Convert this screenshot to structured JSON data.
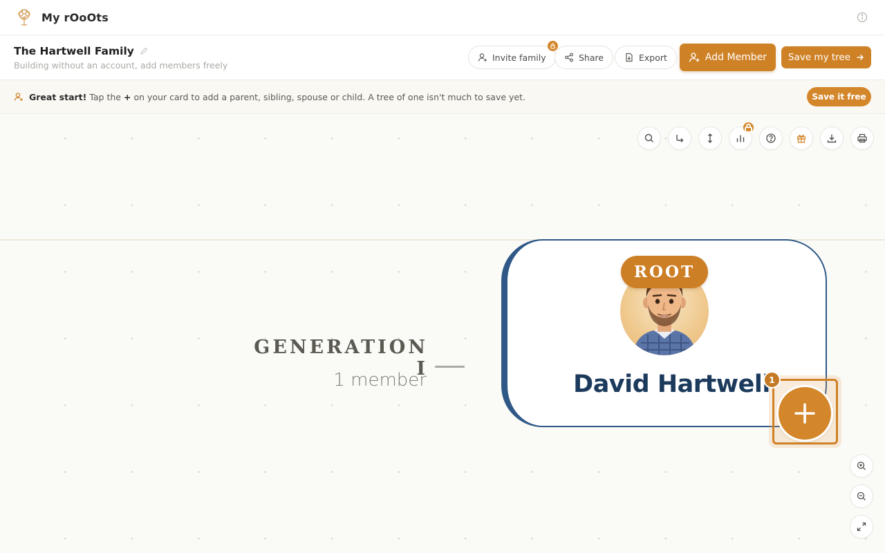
{
  "app": {
    "name": "My rOoOts"
  },
  "family": {
    "title": "The Hartwell Family",
    "subtitle": "Building without an account, add members freely"
  },
  "header_actions": {
    "invite": "Invite family",
    "share": "Share",
    "export": "Export",
    "add_member": "Add Member",
    "save_tree": "Save my tree"
  },
  "tip": {
    "lead": "Great start!",
    "before_plus": "Tap the",
    "plus": "+",
    "after_plus": "on your card to add a parent, sibling, spouse or child. A tree of one isn't much to save yet.",
    "cta": "Save it free"
  },
  "toolbar": {
    "tools": [
      "search-icon",
      "reroute-icon",
      "vertical-expand-icon",
      "stats-icon",
      "help-icon",
      "gift-icon",
      "download-icon",
      "print-icon"
    ],
    "zoom": [
      "zoom-in-icon",
      "zoom-out-icon",
      "fullscreen-icon"
    ]
  },
  "generation": {
    "label": "GENERATION I",
    "count": "1 member"
  },
  "person": {
    "badge": "ROOT",
    "name": "David Hartwell",
    "step": "1"
  },
  "colors": {
    "accent": "#cf8126",
    "card_border": "#2f5886",
    "name": "#1c3a5c"
  }
}
